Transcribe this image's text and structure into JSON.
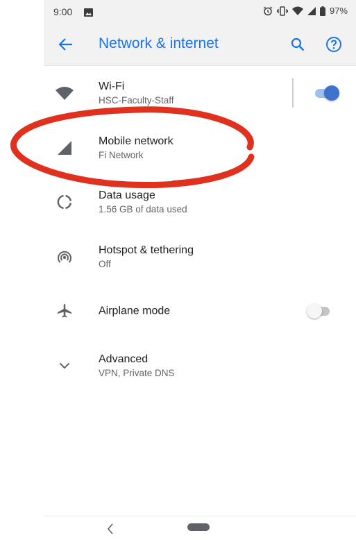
{
  "status_bar": {
    "time": "9:00",
    "battery": "97%",
    "icons": [
      "image-icon",
      "alarm-icon",
      "vibrate-icon",
      "wifi-icon",
      "cell-signal-icon",
      "battery-icon"
    ]
  },
  "app_bar": {
    "title": "Network & internet",
    "accent_color": "#1a73e8",
    "icons": [
      "back-arrow-icon",
      "search-icon",
      "help-icon"
    ]
  },
  "settings": [
    {
      "id": "wifi",
      "title": "Wi-Fi",
      "subtitle": "HSC-Faculty-Staff",
      "icon": "wifi-icon",
      "toggle": true
    },
    {
      "id": "mobile",
      "title": "Mobile network",
      "subtitle": "Fi Network",
      "icon": "cell-signal-icon"
    },
    {
      "id": "data",
      "title": "Data usage",
      "subtitle": "1.56 GB of data used",
      "icon": "data-usage-icon"
    },
    {
      "id": "hotspot",
      "title": "Hotspot & tethering",
      "subtitle": "Off",
      "icon": "hotspot-icon"
    },
    {
      "id": "airplane",
      "title": "Airplane mode",
      "subtitle": "",
      "icon": "airplane-icon",
      "toggle": false
    },
    {
      "id": "advanced",
      "title": "Advanced",
      "subtitle": "VPN, Private DNS",
      "icon": "chevron-down-icon"
    }
  ],
  "colors": {
    "toggle_on_thumb": "#3d73cd",
    "toggle_on_track": "#9ebfef",
    "annotation": "#e0301e"
  },
  "nav_bar": {
    "icons": [
      "nav-back-icon",
      "home-pill-icon"
    ]
  }
}
